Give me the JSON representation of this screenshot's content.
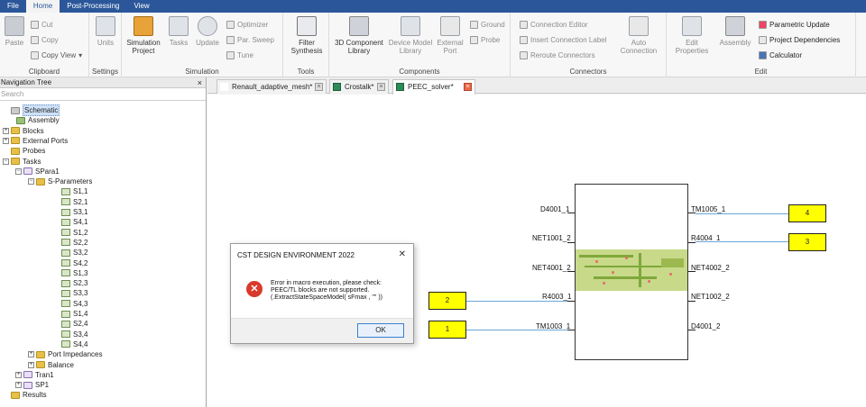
{
  "menubar": {
    "items": [
      "File",
      "Home",
      "Post-Processing",
      "View"
    ],
    "active": "Home"
  },
  "ribbon": {
    "clipboard": {
      "label": "Clipboard",
      "paste": "Paste",
      "cut": "Cut",
      "copy": "Copy",
      "copy_view": "Copy View"
    },
    "settings": {
      "label": "Settings",
      "units": "Units"
    },
    "simulation": {
      "label": "Simulation",
      "sim_project": "Simulation Project",
      "tasks": "Tasks",
      "update": "Update",
      "optimizer": "Optimizer",
      "par_sweep": "Par. Sweep",
      "tune": "Tune"
    },
    "tools": {
      "label": "Tools",
      "filter_synthesis": "Filter Synthesis"
    },
    "components": {
      "label": "Components",
      "comp_3d_lib": "3D Component Library",
      "device_model_lib": "Device Model Library",
      "external_port": "External Port",
      "ground": "Ground",
      "probe": "Probe"
    },
    "connectors": {
      "label": "Connectors",
      "connection_editor": "Connection Editor",
      "insert_conn_label": "Insert Connection Label",
      "reroute": "Reroute Connectors",
      "auto_connection": "Auto Connection"
    },
    "edit": {
      "label": "Edit",
      "edit_properties": "Edit Properties",
      "assembly": "Assembly",
      "parametric_update": "Parametric Update",
      "project_dependencies": "Project Dependencies",
      "calculator": "Calculator"
    }
  },
  "nav": {
    "title": "Navigation Tree",
    "close": "×",
    "search_placeholder": "Search",
    "items": [
      {
        "label": "Schematic",
        "icon": "schematic-icon"
      },
      {
        "label": "Assembly",
        "icon": "assembly-icon"
      },
      {
        "label": "Blocks",
        "icon": "folder-icon"
      },
      {
        "label": "External Ports",
        "icon": "folder-icon"
      },
      {
        "label": "Probes",
        "icon": "folder-icon"
      },
      {
        "label": "Tasks",
        "icon": "folder-icon"
      },
      {
        "label": "SPara1",
        "icon": "task-icon"
      },
      {
        "label": "S-Parameters",
        "icon": "folder-icon"
      },
      {
        "label": "S1,1",
        "icon": "sparam-icon"
      },
      {
        "label": "S2,1",
        "icon": "sparam-icon"
      },
      {
        "label": "S3,1",
        "icon": "sparam-icon"
      },
      {
        "label": "S4,1",
        "icon": "sparam-icon"
      },
      {
        "label": "S1,2",
        "icon": "sparam-icon"
      },
      {
        "label": "S2,2",
        "icon": "sparam-icon"
      },
      {
        "label": "S3,2",
        "icon": "sparam-icon"
      },
      {
        "label": "S4,2",
        "icon": "sparam-icon"
      },
      {
        "label": "S1,3",
        "icon": "sparam-icon"
      },
      {
        "label": "S2,3",
        "icon": "sparam-icon"
      },
      {
        "label": "S3,3",
        "icon": "sparam-icon"
      },
      {
        "label": "S4,3",
        "icon": "sparam-icon"
      },
      {
        "label": "S1,4",
        "icon": "sparam-icon"
      },
      {
        "label": "S2,4",
        "icon": "sparam-icon"
      },
      {
        "label": "S3,4",
        "icon": "sparam-icon"
      },
      {
        "label": "S4,4",
        "icon": "sparam-icon"
      },
      {
        "label": "Port Impedances",
        "icon": "folder-icon"
      },
      {
        "label": "Balance",
        "icon": "folder-icon"
      },
      {
        "label": "Tran1",
        "icon": "task-icon"
      },
      {
        "label": "SP1",
        "icon": "task-icon"
      },
      {
        "label": "Results",
        "icon": "folder-icon"
      }
    ]
  },
  "tabs": [
    {
      "label": "Renault_adaptive_mesh*",
      "close": "×"
    },
    {
      "label": "Crostalk*",
      "close": "×"
    },
    {
      "label": "PEEC_solver*",
      "close": "×"
    }
  ],
  "schematic": {
    "left_pins": [
      "D4001_1",
      "NET1001_2",
      "NET4001_2",
      "R4003_1",
      "TM1003_1"
    ],
    "right_pins": [
      "TM1005_1",
      "R4004_1",
      "NET4002_2",
      "NET1002_2",
      "D4001_2"
    ],
    "ports": [
      "4",
      "3",
      "2",
      "1"
    ]
  },
  "dialog": {
    "title": "CST DESIGN ENVIRONMENT 2022",
    "close": "✕",
    "err_glyph": "✕",
    "line1": "Error in macro execution, please check:",
    "line2": "PEEC/TL blocks are not supported.",
    "line3": "(.ExtractStateSpaceModel( sFmax , \"\" ))",
    "ok": "OK"
  },
  "colors": {
    "menubar_bg": "#2b579a",
    "port_fill": "#ffff00",
    "wire": "#6aa6d8",
    "error_red": "#d93a2b"
  }
}
